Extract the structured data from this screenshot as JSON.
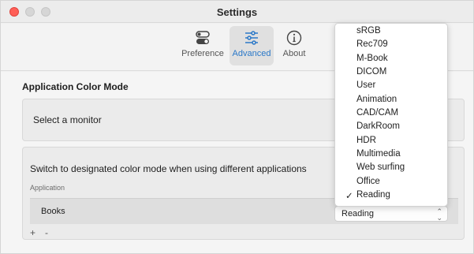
{
  "window": {
    "title": "Settings"
  },
  "toolbar": {
    "items": [
      {
        "label": "Preference",
        "icon": "toggle-icon"
      },
      {
        "label": "Advanced",
        "icon": "sliders-icon",
        "selected": true
      },
      {
        "label": "About",
        "icon": "info-icon"
      }
    ]
  },
  "section": {
    "title": "Application Color Mode"
  },
  "monitor_card": {
    "text": "Select a monitor"
  },
  "apps_card": {
    "text": "Switch to designated color mode when using different applications",
    "column_header": "Application",
    "rows": [
      {
        "app": "Books",
        "mode": "Reading"
      }
    ],
    "add_label": "+",
    "remove_label": "-"
  },
  "color_mode_menu": {
    "options": [
      "sRGB",
      "Rec709",
      "M-Book",
      "DICOM",
      "User",
      "Animation",
      "CAD/CAM",
      "DarkRoom",
      "HDR",
      "Multimedia",
      "Web surfing",
      "Office",
      "Reading"
    ],
    "selected": "Reading",
    "check_mark": "✓"
  },
  "colors": {
    "accent": "#2a78c8",
    "close": "#ff5f57"
  }
}
